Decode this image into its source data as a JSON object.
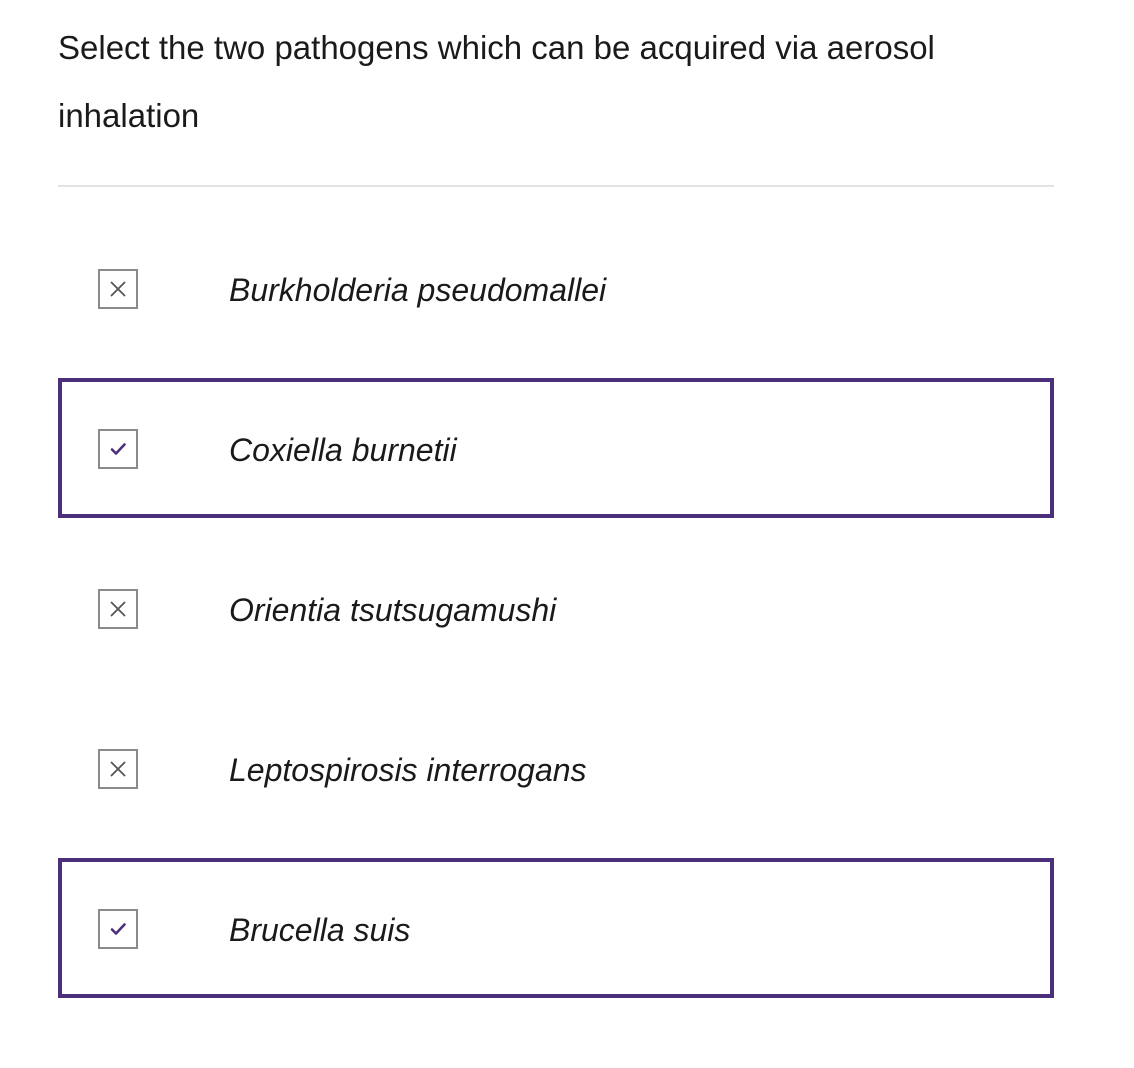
{
  "question": {
    "text": "Select the two pathogens which can be acquired via aerosol inhalation"
  },
  "colors": {
    "selected_border": "#4b2f7a",
    "check": "#4b2f7a",
    "cross": "#555555",
    "box_border": "#8a8a8a",
    "divider": "#e3e3e3"
  },
  "options": [
    {
      "label": "Burkholderia pseudomallei",
      "selected": false,
      "icon": "cross-icon"
    },
    {
      "label": "Coxiella burnetii",
      "selected": true,
      "icon": "check-icon"
    },
    {
      "label": "Orientia tsutsugamushi",
      "selected": false,
      "icon": "cross-icon"
    },
    {
      "label": "Leptospirosis interrogans",
      "selected": false,
      "icon": "cross-icon"
    },
    {
      "label": "Brucella suis",
      "selected": true,
      "icon": "check-icon"
    }
  ]
}
